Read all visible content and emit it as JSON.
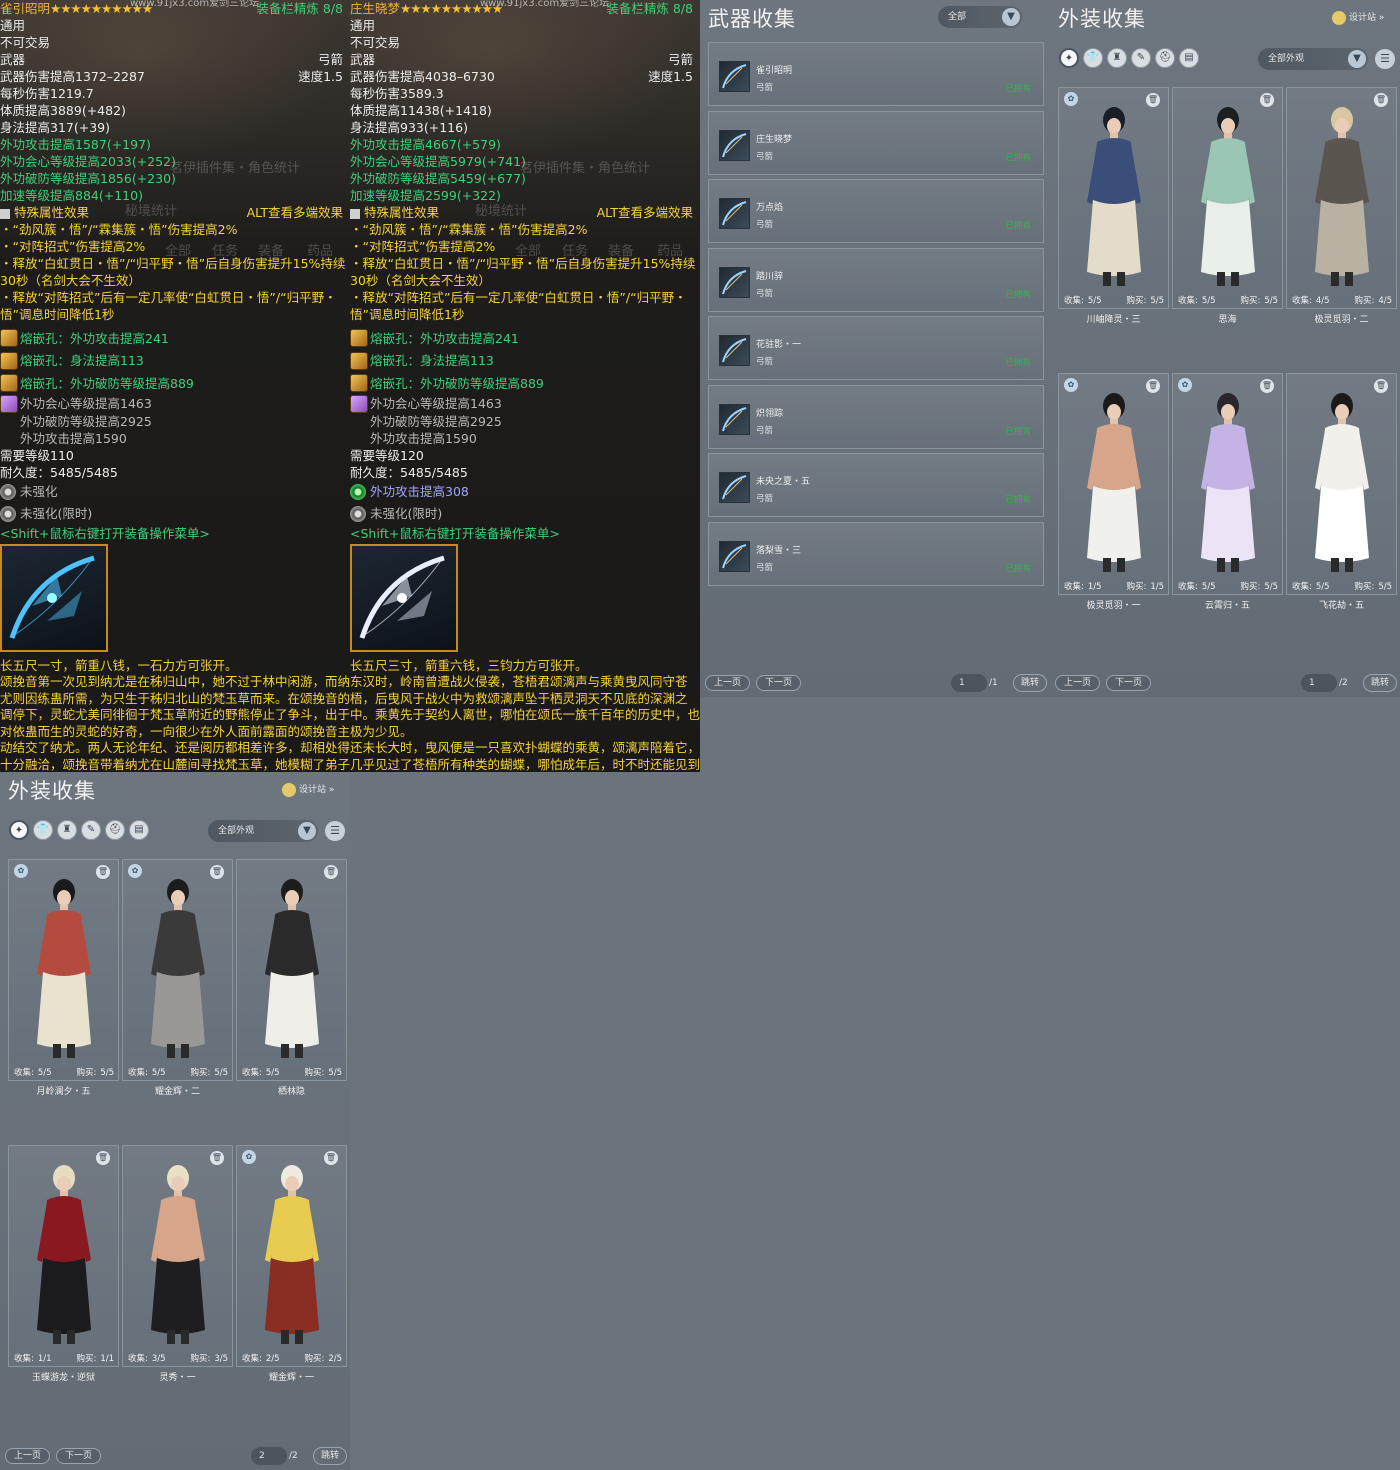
{
  "tooltips": [
    {
      "name": "雀引昭明",
      "stars": "★★★★★★★★★★",
      "url_wm": "www.91jx3.com爱剑三论坛",
      "refine": "装备栏精炼 8/8",
      "bind": "通用",
      "trade": "不可交易",
      "slot": "武器",
      "kind": "弓箭",
      "dmg": "武器伤害提高1372–2287",
      "speed": "速度1.5",
      "dps": "每秒伤害1219.7",
      "attr": [
        {
          "t": "体质提高3889",
          "e": "(+482)",
          "c": "white"
        },
        {
          "t": "身法提高317",
          "e": "(+39)",
          "c": "white"
        },
        {
          "t": "外功攻击提高1587",
          "e": "(+197)",
          "c": "green"
        },
        {
          "t": "外功会心等级提高2033",
          "e": "(+252)",
          "c": "green"
        },
        {
          "t": "外功破防等级提高1856",
          "e": "(+230)",
          "c": "green"
        },
        {
          "t": "加速等级提高884",
          "e": "(+110)",
          "c": "green"
        }
      ],
      "special_title": "特殊属性效果",
      "alt": "ALT查看多端效果",
      "bullets": [
        "・“劲风簇・悟”/“霖集簇・悟”伤害提高2%",
        "・“对阵招式”伤害提高2%",
        "・释放“白虹贯日・悟”/“归平野・悟”后自身伤害提升15%持续30秒（名剑大会不生效）",
        "・释放“对阵招式”后有一定几率使“白虹贯日・悟”/“归平野・悟”调息时间降低1秒"
      ],
      "gems": [
        "熔嵌孔：外功攻击提高241",
        "熔嵌孔：身法提高113",
        "熔嵌孔：外功破防等级提高889"
      ],
      "set": [
        "外功会心等级提高1463",
        "外功破防等级提高2925",
        "外功攻击提高1590"
      ],
      "req": "需要等级110",
      "dur": "耐久度：5485/5485",
      "enh1": "未强化",
      "enh1_color": "gray",
      "enh2": "未强化(限时)",
      "menu": "<Shift+鼠标右键打开装备操作菜单>",
      "lore": "长五尺一寸，箭重八钱，一石力方可张开。\n颂挽音第一次见到纳尤是在秭归山中，她不过于林中闲游，而纳尤则因练蛊所需，为只生于秭归北山的梵玉草而来。在颂挽音的调停下，灵蛇尤美同徘徊于梵玉草附近的野熊停止了争斗，出于对依蛊而生的灵蛇的好奇，一向很少在外人面前露面的颂挽音主动结交了纳尤。两人无论年纪、还是阅历都相差许多，却相处得十分融洽，颂挽音带着纳尤在山麓间寻找梵玉草，她模糊了弟子与对师父身份的敬之意，而如"
    },
    {
      "name": "庄生晓梦",
      "stars": "★★★★★★★★★★",
      "url_wm": "www.91jx3.com爱剑三论坛",
      "refine": "装备栏精炼 8/8",
      "bind": "通用",
      "trade": "不可交易",
      "slot": "武器",
      "kind": "弓箭",
      "dmg": "武器伤害提高4038–6730",
      "speed": "速度1.5",
      "dps": "每秒伤害3589.3",
      "attr": [
        {
          "t": "体质提高11438",
          "e": "(+1418)",
          "c": "white"
        },
        {
          "t": "身法提高933",
          "e": "(+116)",
          "c": "white"
        },
        {
          "t": "外功攻击提高4667",
          "e": "(+579)",
          "c": "green"
        },
        {
          "t": "外功会心等级提高5979",
          "e": "(+741)",
          "c": "green"
        },
        {
          "t": "外功破防等级提高5459",
          "e": "(+677)",
          "c": "green"
        },
        {
          "t": "加速等级提高2599",
          "e": "(+322)",
          "c": "green"
        }
      ],
      "special_title": "特殊属性效果",
      "alt": "ALT查看多端效果",
      "bullets": [
        "・“劲风簇・悟”/“霖集簇・悟”伤害提高2%",
        "・“对阵招式”伤害提高2%",
        "・释放“白虹贯日・悟”/“归平野・悟”后自身伤害提升15%持续30秒（名剑大会不生效）",
        "・释放“对阵招式”后有一定几率使“白虹贯日・悟”/“归平野・悟”调息时间降低1秒"
      ],
      "gems": [
        "熔嵌孔：外功攻击提高241",
        "熔嵌孔：身法提高113",
        "熔嵌孔：外功破防等级提高889"
      ],
      "set": [
        "外功会心等级提高1463",
        "外功破防等级提高2925",
        "外功攻击提高1590"
      ],
      "req": "需要等级120",
      "dur": "耐久度：5485/5485",
      "enh1": "外功攻击提高308",
      "enh1_color": "purple",
      "enh2": "未强化(限时)",
      "menu": "<Shift+鼠标右键打开装备操作菜单>",
      "lore": "长五尺三寸，箭重六钱，三钧力方可张开。\n东汉时，岭南曾遭战火侵袭，苍梧君颂漓声与乘黄曳风同守苍梧，后曳风于战火中为救颂漓声坠于栖灵洞天不见底的深渊之中。乘黄先于契约人离世，哪怕在颂氏一族千百年的历史中，也极为少见。\n还未长大时，曳风便是一只喜欢扑蝴蝶的乘黄，颂漓声陪着它，几乎见过了苍梧所有种类的蝴蝶，哪怕成年后，时不时还能见到蝴蝶停驻在曳风身上小憩，它的尾巴轻晃着上下的"
    }
  ],
  "bg_watermarks": [
    "茗伊插件集・角色统计",
    "秘境统计",
    "全部",
    "任务",
    "装备",
    "药品"
  ],
  "weapons": {
    "title": "武器收集",
    "filter": "全部",
    "items": [
      {
        "name": "雀引昭明",
        "type": "弓箭",
        "status": "已拥有"
      },
      {
        "name": "庄生晓梦",
        "type": "弓箭",
        "status": "已拥有"
      },
      {
        "name": "万点焰",
        "type": "弓箭",
        "status": "已拥有"
      },
      {
        "name": "踏川骍",
        "type": "弓箭",
        "status": "已拥有"
      },
      {
        "name": "花驻影・一",
        "type": "弓箭",
        "status": "已拥有"
      },
      {
        "name": "炽翎踪",
        "type": "弓箭",
        "status": "已拥有"
      },
      {
        "name": "未央之夏・五",
        "type": "弓箭",
        "status": "已拥有"
      },
      {
        "name": "落梨雪・三",
        "type": "弓箭",
        "status": "已拥有"
      }
    ],
    "prev": "上一页",
    "next": "下一页",
    "page": "1",
    "total": "/1",
    "jump": "跳转"
  },
  "outfits1": {
    "title": "外装收集",
    "designer": "设计站",
    "filter": "全部外观",
    "collect_label": "收集:",
    "buy_label": "购买:",
    "cards": [
      {
        "name": "川岫降灵・三",
        "collect": "5/5",
        "buy": "5/5",
        "badge": true,
        "palette": [
          "#1a1e28",
          "#3a4e7a",
          "#e4dccb"
        ]
      },
      {
        "name": "思海",
        "collect": "5/5",
        "buy": "5/5",
        "badge": false,
        "palette": [
          "#1a1f22",
          "#9cc6b4",
          "#e9efe9"
        ]
      },
      {
        "name": "极灵觅羽・二",
        "collect": "4/5",
        "buy": "4/5",
        "badge": false,
        "palette": [
          "#d8c7a0",
          "#5b5550",
          "#b9b2a2"
        ]
      },
      {
        "name": "极灵觅羽・一",
        "collect": "1/5",
        "buy": "1/5",
        "badge": true,
        "palette": [
          "#1b1a1a",
          "#d6a58a",
          "#f0f0ec"
        ]
      },
      {
        "name": "云霄归・五",
        "collect": "5/5",
        "buy": "5/5",
        "badge": true,
        "palette": [
          "#2a2630",
          "#c4b4e6",
          "#ece4f6"
        ]
      },
      {
        "name": "飞花劫・五",
        "collect": "5/5",
        "buy": "5/5",
        "badge": false,
        "palette": [
          "#1b1a1a",
          "#f2f0ea",
          "#ffffff"
        ]
      }
    ],
    "prev": "上一页",
    "next": "下一页",
    "page": "1",
    "total": "/2",
    "jump": "跳转"
  },
  "outfits2": {
    "title": "外装收集",
    "designer": "设计站",
    "filter": "全部外观",
    "collect_label": "收集:",
    "buy_label": "购买:",
    "cards": [
      {
        "name": "月岭澜夕・五",
        "collect": "5/5",
        "buy": "5/5",
        "badge": true,
        "palette": [
          "#1a1a1c",
          "#b54a3e",
          "#e9e2cf"
        ]
      },
      {
        "name": "耀金辉・二",
        "collect": "5/5",
        "buy": "5/5",
        "badge": true,
        "palette": [
          "#1d1c1c",
          "#3b3a3a",
          "#9a9894"
        ]
      },
      {
        "name": "栖林隐",
        "collect": "5/5",
        "buy": "5/5",
        "badge": false,
        "palette": [
          "#1d1c1c",
          "#2a2a2a",
          "#f0eee8"
        ]
      },
      {
        "name": "玉蝶游龙・逆狱",
        "collect": "1/1",
        "buy": "1/1",
        "badge": false,
        "palette": [
          "#e6dcc0",
          "#8a1820",
          "#1b1a1c"
        ]
      },
      {
        "name": "灵秀・一",
        "collect": "3/5",
        "buy": "3/5",
        "badge": false,
        "palette": [
          "#e9dfc5",
          "#d6a58a",
          "#1e1d1f"
        ]
      },
      {
        "name": "耀金辉・一",
        "collect": "2/5",
        "buy": "2/5",
        "badge": true,
        "palette": [
          "#eeeae0",
          "#e8cc52",
          "#8a2e24"
        ]
      }
    ],
    "prev": "上一页",
    "next": "下一页",
    "page": "2",
    "total": "/2",
    "jump": "跳转"
  }
}
